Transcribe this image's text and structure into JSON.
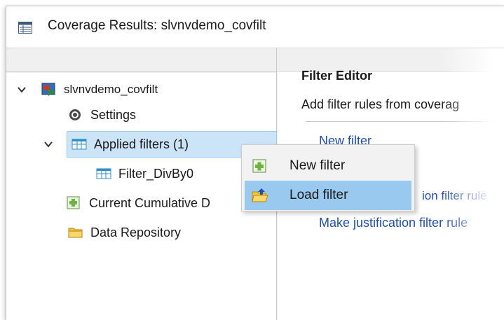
{
  "window": {
    "title": "Coverage Results: slvnvdemo_covfilt",
    "title_icon": "table-window-icon"
  },
  "tree": {
    "items": [
      {
        "label": "slvnvdemo_covfilt",
        "icon": "simulink-model-icon",
        "expanded": true
      },
      {
        "label": "Settings",
        "icon": "gear-icon"
      },
      {
        "label": "Applied filters (1)",
        "icon": "filter-table-icon",
        "expanded": true,
        "selected": true
      },
      {
        "label": "Filter_DivBy0",
        "icon": "filter-table-icon"
      },
      {
        "label": "Current Cumulative D",
        "icon": "add-data-icon"
      },
      {
        "label": "Data Repository",
        "icon": "folder-icon"
      }
    ]
  },
  "editor": {
    "title": "Filter Editor",
    "description": "Add filter rules from coverag",
    "links": {
      "new_filter": "New filter",
      "justification_rule_partial": "ion filter rule",
      "make_justification": "Make justification filter rule"
    }
  },
  "context_menu": {
    "items": [
      {
        "label": "New filter",
        "icon": "new-filter-icon"
      },
      {
        "label": "Load filter",
        "icon": "open-folder-icon",
        "highlighted": true
      }
    ]
  },
  "colors": {
    "selection": "#cce4f7",
    "menu_highlight": "#99c9ef",
    "link": "#1f4fa8"
  }
}
